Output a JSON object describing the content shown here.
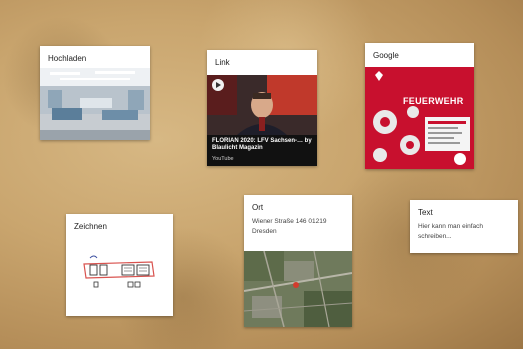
{
  "cards": {
    "upload": {
      "title": "Hochladen"
    },
    "link": {
      "title": "Link",
      "video_caption": "FLORIAN 2020: LFV Sachsen-… by Blaulicht Magazin",
      "video_source": "YouTube"
    },
    "google": {
      "title": "Google",
      "poster_headline": "FEUERWEHR"
    },
    "draw": {
      "title": "Zeichnen"
    },
    "ort": {
      "title": "Ort",
      "address": "Wiener Straße 146 01219 Dresden"
    },
    "text": {
      "title": "Text",
      "body": "Hier kann man einfach schreiben..."
    }
  },
  "colors": {
    "poster_red": "#c8102e",
    "sketch_red": "#d9534f",
    "sketch_blue": "#3b4fa0"
  }
}
